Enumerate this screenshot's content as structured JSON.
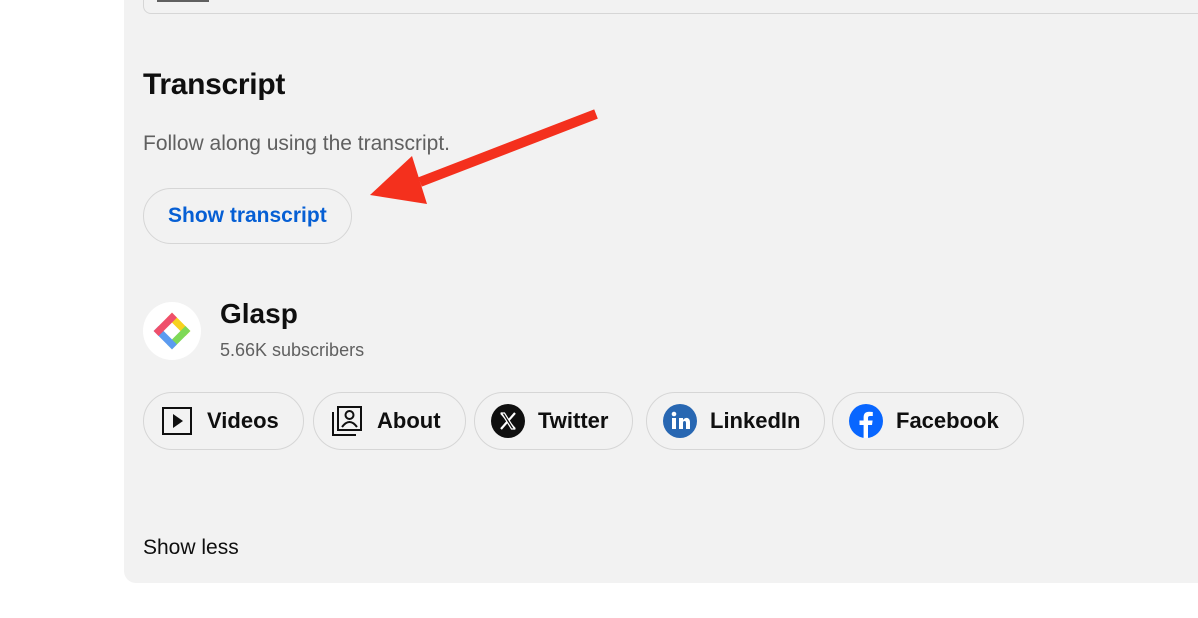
{
  "transcript": {
    "heading": "Transcript",
    "description": "Follow along using the transcript.",
    "button_label": "Show transcript"
  },
  "channel": {
    "name": "Glasp",
    "subscribers": "5.66K subscribers",
    "avatar_icon": "glasp-logo-icon"
  },
  "links": [
    {
      "label": "Videos",
      "icon": "play-icon"
    },
    {
      "label": "About",
      "icon": "portrait-icon"
    },
    {
      "label": "Twitter",
      "icon": "x-logo-icon"
    },
    {
      "label": "LinkedIn",
      "icon": "linkedin-icon"
    },
    {
      "label": "Facebook",
      "icon": "facebook-icon"
    }
  ],
  "footer": {
    "show_less_label": "Show less"
  },
  "colors": {
    "panel_bg": "#f2f2f2",
    "link_blue": "#065fd4",
    "annotation_arrow": "#f4301d",
    "linkedin_blue": "#2867b2",
    "facebook_blue": "#0866ff"
  }
}
